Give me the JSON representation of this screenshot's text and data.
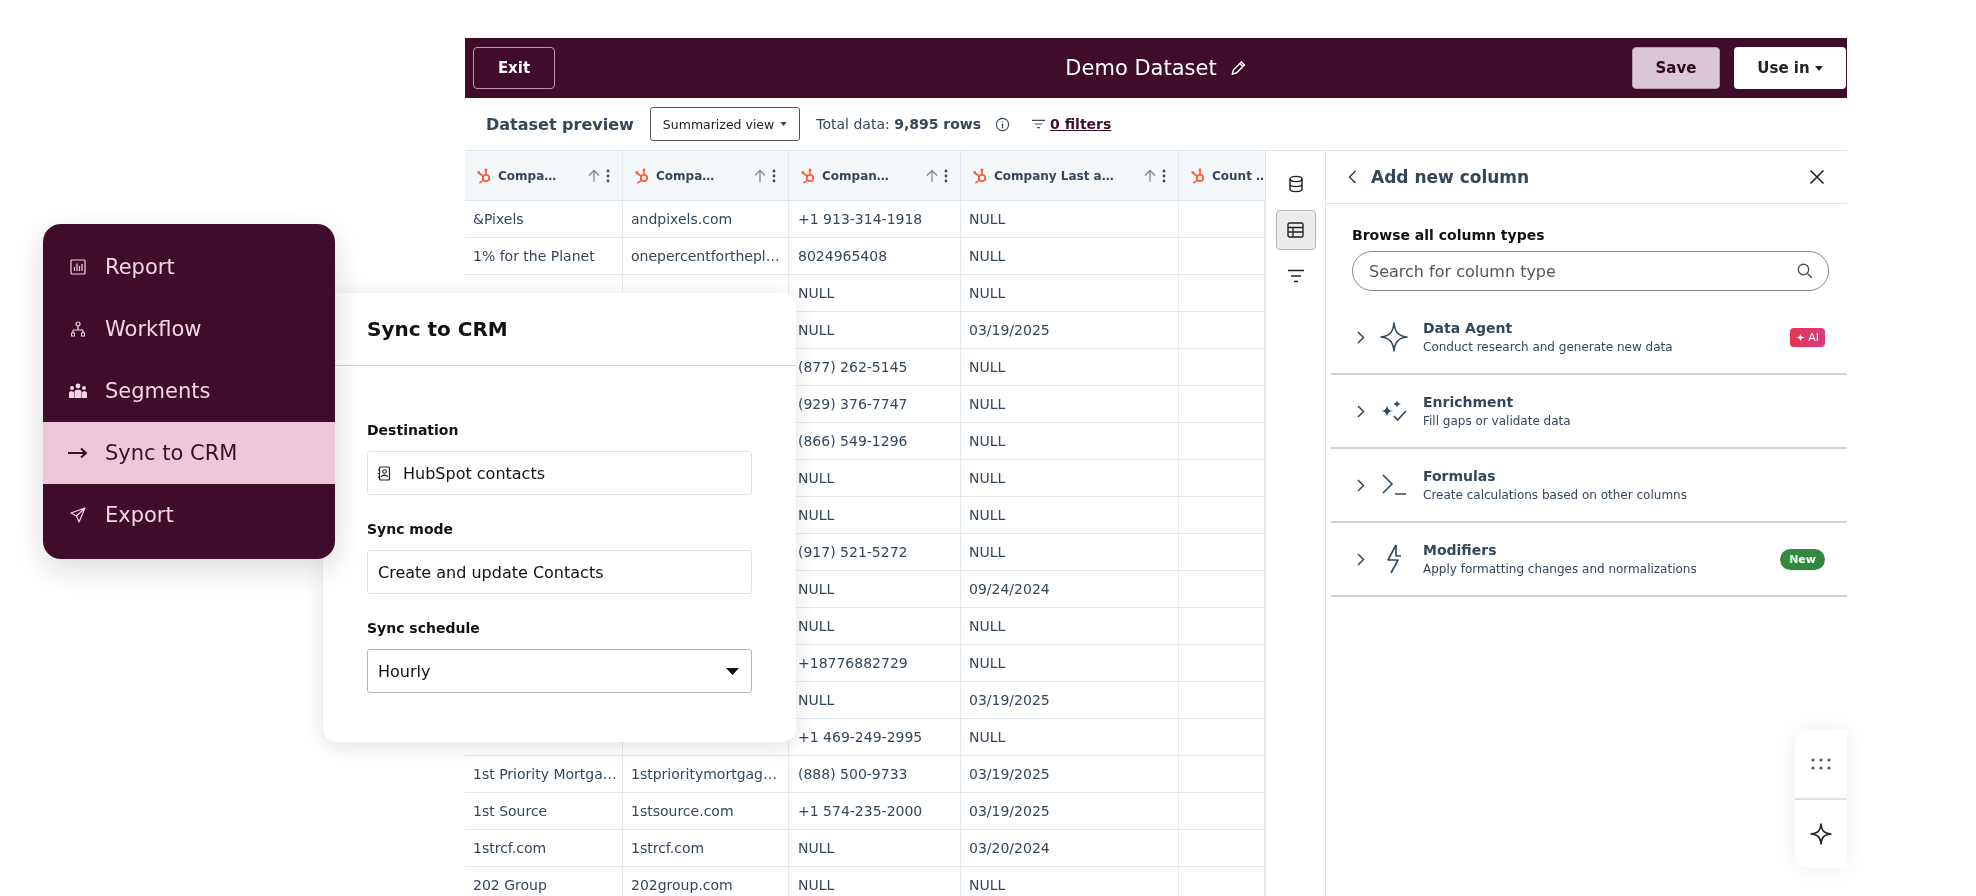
{
  "toolbar": {
    "exit": "Exit",
    "title": "Demo Dataset",
    "save": "Save",
    "use_in": "Use in"
  },
  "subbar": {
    "title": "Dataset preview",
    "view": "Summarized view",
    "total": "Total data: **9,895 rows**",
    "filters": "0 filters"
  },
  "table": {
    "columns": [
      {
        "label": "Compa…",
        "kind": "full"
      },
      {
        "label": "Compa…",
        "kind": "full"
      },
      {
        "label": "Compan…",
        "kind": "full"
      },
      {
        "label": "Company Last a…",
        "kind": "full"
      },
      {
        "label": "Count …",
        "kind": "clipped"
      }
    ],
    "rows": [
      [
        "&Pixels",
        "andpixels.com",
        "+1 913-314-1918",
        "NULL"
      ],
      [
        "1% for the Planet",
        "onepercentforthepl…",
        "8024965408",
        "NULL"
      ],
      [
        null,
        null,
        "NULL",
        "NULL"
      ],
      [
        null,
        null,
        "NULL",
        "03/19/2025"
      ],
      [
        null,
        null,
        "(877) 262-5145",
        "NULL"
      ],
      [
        null,
        null,
        "(929) 376-7747",
        "NULL"
      ],
      [
        null,
        null,
        "(866) 549-1296",
        "NULL"
      ],
      [
        null,
        null,
        "NULL",
        "NULL"
      ],
      [
        null,
        null,
        "NULL",
        "NULL"
      ],
      [
        null,
        null,
        "(917) 521-5272",
        "NULL"
      ],
      [
        null,
        null,
        "NULL",
        "09/24/2024"
      ],
      [
        null,
        null,
        "NULL",
        "NULL"
      ],
      [
        null,
        null,
        "+18776882729",
        "NULL"
      ],
      [
        null,
        null,
        "NULL",
        "03/19/2025"
      ],
      [
        null,
        null,
        "+1 469-249-2995",
        "NULL"
      ],
      [
        "1st Priority Mortga…",
        "1stprioritymortgag…",
        "(888) 500-9733",
        "03/19/2025"
      ],
      [
        "1st Source",
        "1stsource.com",
        "+1 574-235-2000",
        "03/19/2025"
      ],
      [
        "1strcf.com",
        "1strcf.com",
        "NULL",
        "03/20/2024"
      ],
      [
        "202 Group",
        "202group.com",
        "NULL",
        "NULL"
      ]
    ]
  },
  "side_tools": [
    {
      "kind": "database",
      "selected": false
    },
    {
      "kind": "table",
      "selected": true
    },
    {
      "kind": "filter",
      "selected": false
    }
  ],
  "panel": {
    "title": "Add new column",
    "section": "Browse all column types",
    "search": {
      "placeholder": "Search for column type"
    },
    "items": [
      {
        "kind": "agent",
        "name": "Data Agent",
        "description": "Conduct research and generate new data",
        "badge": {
          "kind": "ai",
          "label": "AI"
        }
      },
      {
        "kind": "enrichment",
        "name": "Enrichment",
        "description": "Fill gaps or validate data"
      },
      {
        "kind": "formula",
        "name": "Formulas",
        "description": "Create calculations based on other columns"
      },
      {
        "kind": "modifier",
        "name": "Modifiers",
        "description": "Apply formatting changes and normalizations",
        "badge": {
          "kind": "new",
          "label": "New"
        }
      }
    ]
  },
  "menu": {
    "items": [
      {
        "kind": "report",
        "label": "Report",
        "selected": false
      },
      {
        "kind": "workflow",
        "label": "Workflow",
        "selected": false
      },
      {
        "kind": "segments",
        "label": "Segments",
        "selected": false
      },
      {
        "kind": "sync",
        "label": "Sync to CRM",
        "selected": true
      },
      {
        "kind": "export",
        "label": "Export",
        "selected": false
      }
    ]
  },
  "sync": {
    "title": "Sync to CRM",
    "fields": [
      {
        "label": "Destination",
        "value": "HubSpot contacts",
        "kind": "contact"
      },
      {
        "label": "Sync mode",
        "value": "Create and update Contacts",
        "kind": "text"
      },
      {
        "label": "Sync schedule",
        "value": "Hourly",
        "kind": "select"
      }
    ]
  }
}
